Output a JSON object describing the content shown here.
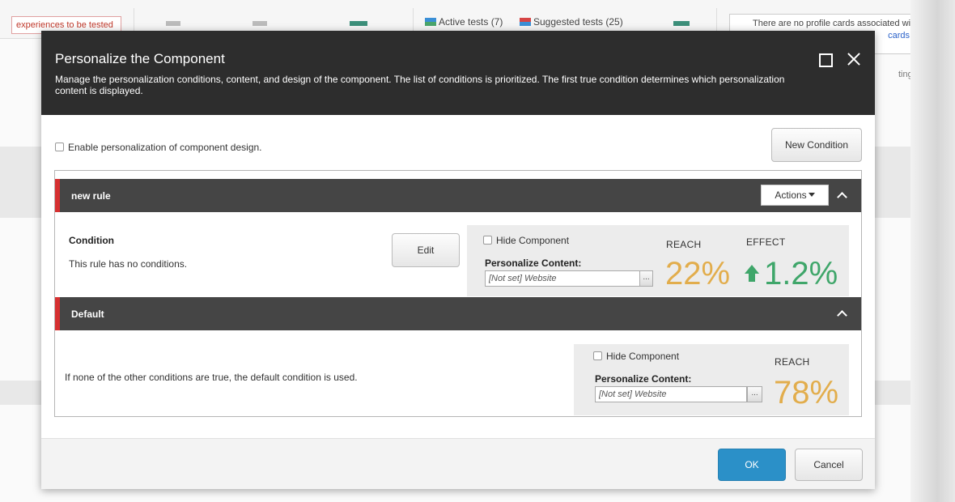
{
  "background": {
    "experiences_text": "experiences to be tested",
    "active_tests": "Active tests (7)",
    "suggested_tests": "Suggested tests (25)",
    "profile_cards_text": "There are no profile cards associated with",
    "profile_cards_link": "cards",
    "settings_text": "tings"
  },
  "dialog": {
    "title": "Personalize the Component",
    "description": "Manage the personalization conditions, content, and design of the component. The list of conditions is prioritized. The first true condition determines which personalization content is displayed.",
    "enable_design_label": "Enable personalization of component design.",
    "new_condition_label": "New Condition"
  },
  "rules": [
    {
      "name": "new rule",
      "actions_label": "Actions",
      "condition_label": "Condition",
      "condition_text": "This rule has no conditions.",
      "edit_label": "Edit",
      "hide_component_label": "Hide Component",
      "personalize_content_label": "Personalize Content:",
      "content_value": "[Not set] Website",
      "browse_label": "...",
      "reach_label": "REACH",
      "reach_value": "22%",
      "effect_label": "EFFECT",
      "effect_value": "1.2%"
    },
    {
      "name": "Default",
      "description": "If none of the other conditions are true, the default condition is used.",
      "hide_component_label": "Hide Component",
      "personalize_content_label": "Personalize Content:",
      "content_value": "[Not set] Website",
      "browse_label": "...",
      "reach_label": "REACH",
      "reach_value": "78%"
    }
  ],
  "footer": {
    "ok_label": "OK",
    "cancel_label": "Cancel"
  },
  "colors": {
    "header_bg": "#2d2d2d",
    "rule_bar_bg": "#454545",
    "rule_accent": "#d63031",
    "reach_color": "#e2ad4c",
    "effect_color": "#3fa66a",
    "ok_button": "#2b90c8"
  }
}
